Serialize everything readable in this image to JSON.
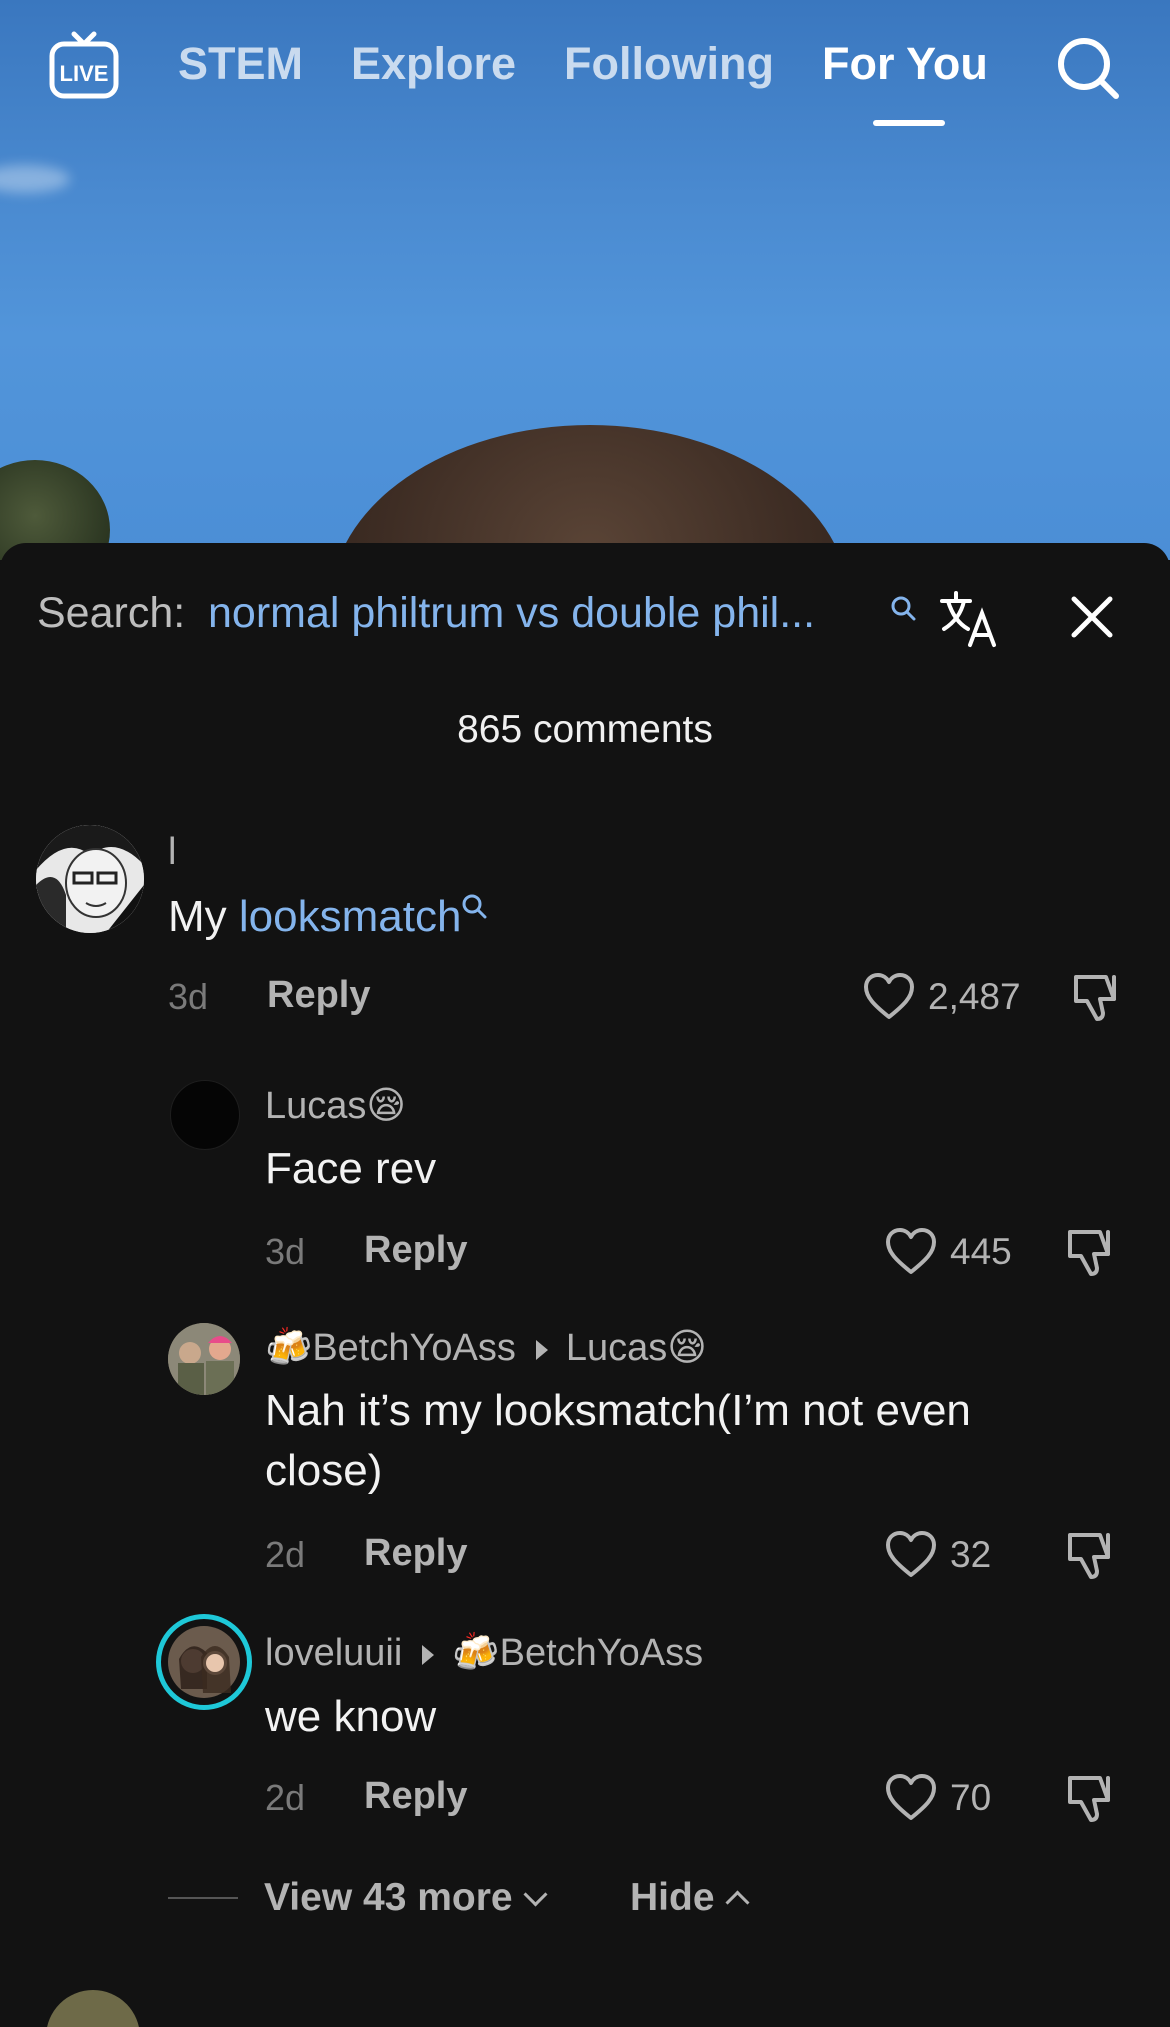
{
  "nav": {
    "live_label": "LIVE",
    "tabs": [
      "STEM",
      "Explore",
      "Following",
      "For You"
    ],
    "active_tab": "For You"
  },
  "sheet": {
    "search_prefix": "Search:",
    "search_query": "normal philtrum vs double phil...",
    "comment_count": "865 comments"
  },
  "comments": [
    {
      "username": "l",
      "text_prefix": "My ",
      "text_link": "looksmatch",
      "time": "3d",
      "reply_label": "Reply",
      "likes": "2,487"
    },
    {
      "username": "Lucas",
      "username_emoji": "😪",
      "text": "Face rev",
      "time": "3d",
      "reply_label": "Reply",
      "likes": "445"
    },
    {
      "username_emoji": "🍻",
      "username": "BetchYoAss",
      "reply_to": "Lucas",
      "reply_to_emoji": "😪",
      "text": "Nah it’s my looksmatch(I’m not even close)",
      "time": "2d",
      "reply_label": "Reply",
      "likes": "32"
    },
    {
      "username": "loveluuii",
      "reply_to_emoji": "🍻",
      "reply_to": "BetchYoAss",
      "text": "we know",
      "time": "2d",
      "reply_label": "Reply",
      "likes": "70"
    }
  ],
  "thread_controls": {
    "view_more": "View 43 more",
    "hide": "Hide"
  },
  "colors": {
    "link": "#84b4ec",
    "sheet_bg": "#121212",
    "story_ring": "#1ec8d8"
  }
}
